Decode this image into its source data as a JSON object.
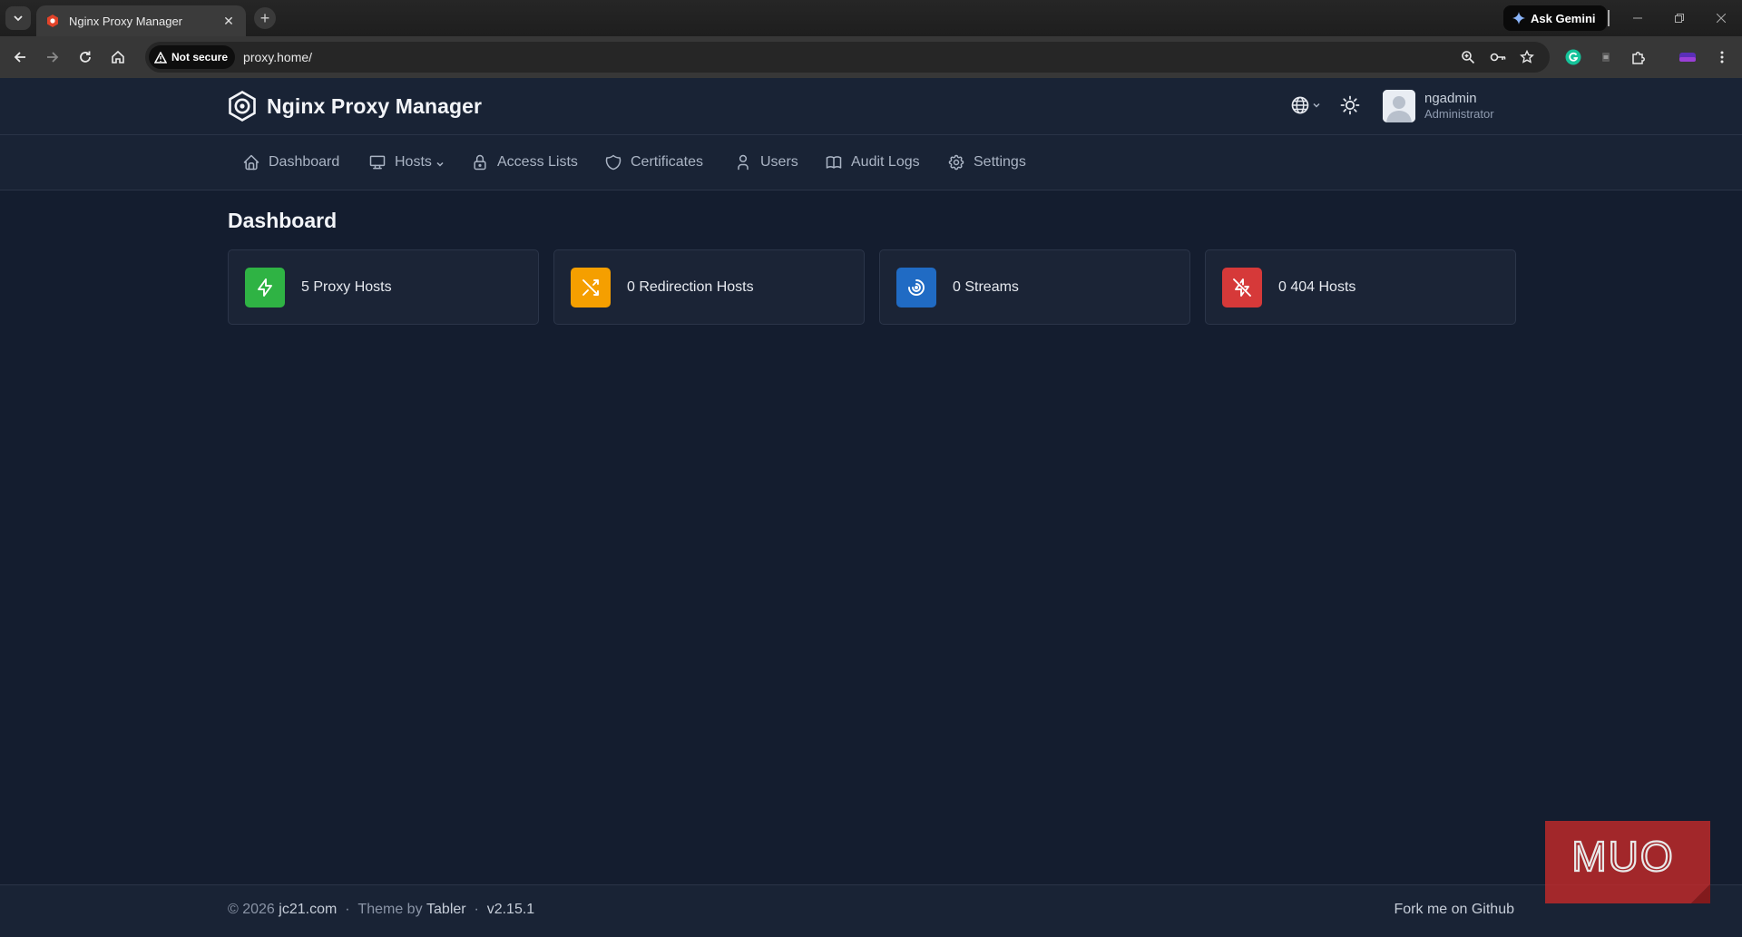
{
  "browser": {
    "tab_title": "Nginx Proxy Manager",
    "new_tab_symbol": "+",
    "close_symbol": "✕",
    "gemini_label": "Ask Gemini",
    "security_chip": "Not secure",
    "url": "proxy.home/"
  },
  "app": {
    "brand_name": "Nginx Proxy Manager",
    "user": {
      "name": "ngadmin",
      "role": "Administrator"
    },
    "nav": [
      {
        "label": "Dashboard",
        "icon": "home-icon"
      },
      {
        "label": "Hosts",
        "icon": "monitor-icon",
        "has_dropdown": true
      },
      {
        "label": "Access Lists",
        "icon": "lock-icon"
      },
      {
        "label": "Certificates",
        "icon": "shield-icon"
      },
      {
        "label": "Users",
        "icon": "user-icon"
      },
      {
        "label": "Audit Logs",
        "icon": "book-icon"
      },
      {
        "label": "Settings",
        "icon": "gear-icon"
      }
    ]
  },
  "main": {
    "page_title": "Dashboard",
    "cards": [
      {
        "label": "5 Proxy Hosts",
        "icon": "bolt-icon",
        "color": "#2fb344"
      },
      {
        "label": "0 Redirection Hosts",
        "icon": "shuffle-icon",
        "color": "#f59f00"
      },
      {
        "label": "0 Streams",
        "icon": "stream-icon",
        "color": "#206bc4"
      },
      {
        "label": "0 404 Hosts",
        "icon": "bolt-off-icon",
        "color": "#d63939"
      }
    ]
  },
  "footer": {
    "copyright": "© 2026 ",
    "copyright_link": "jc21.com",
    "sep1": "  ·  ",
    "theme_prefix": "Theme by ",
    "theme_link": "Tabler",
    "sep2": "  ·  ",
    "version": "v2.15.1",
    "github": "Fork me on Github"
  },
  "watermark": {
    "text": "MUO"
  },
  "colors": {
    "page_bg": "#141d2f",
    "header_bg": "#192335",
    "card_bg": "#1b2436",
    "nav_text": "#aab4c4"
  }
}
